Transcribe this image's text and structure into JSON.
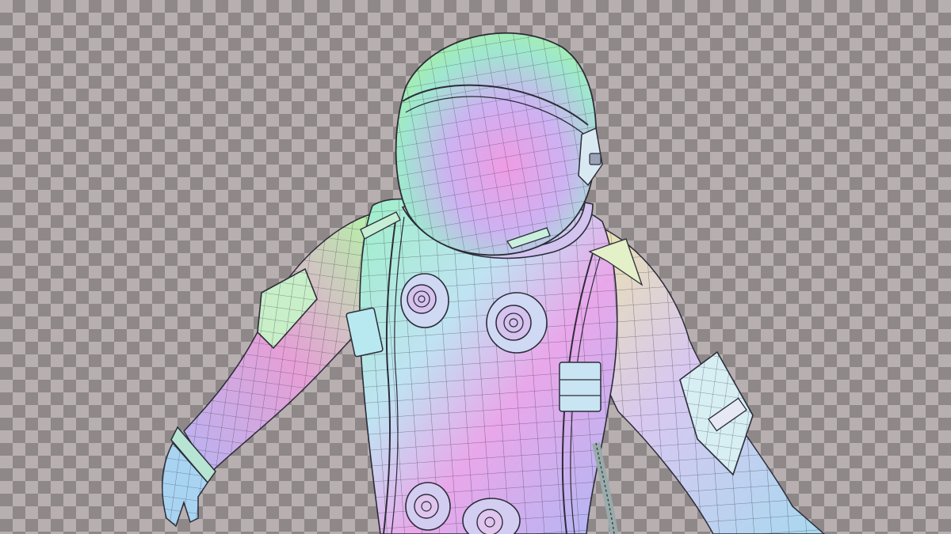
{
  "scene": {
    "subject": "astronaut-wireframe-model",
    "background_pattern": "transparency-checkerboard",
    "checker_light": "#b7afb0",
    "checker_dark": "#8f8889",
    "wire_color": "#2c2c38"
  }
}
